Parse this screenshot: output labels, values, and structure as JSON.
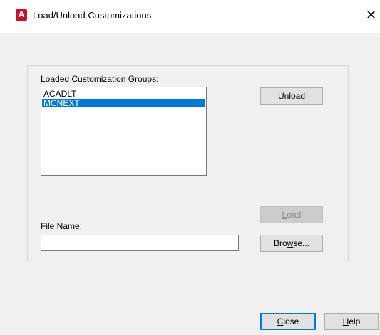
{
  "window": {
    "title": "Load/Unload Customizations",
    "close_glyph": "✕",
    "app_icon_letter": "A",
    "icon": "autocad-app-icon"
  },
  "groups": {
    "label": "Loaded Customization Groups:",
    "items": [
      "ACADLT",
      "MCNEXT"
    ],
    "selected_index": 1
  },
  "buttons": {
    "unload": {
      "pre": "",
      "key": "U",
      "post": "nload"
    },
    "load": {
      "pre": "",
      "key": "L",
      "post": "oad",
      "disabled": true
    },
    "browse": {
      "pre": "Bro",
      "key": "w",
      "post": "se..."
    },
    "close": {
      "pre": "",
      "key": "C",
      "post": "lose"
    },
    "help": {
      "pre": "",
      "key": "H",
      "post": "elp"
    }
  },
  "file_name": {
    "label_key": "F",
    "label_rest": "ile Name:",
    "value": ""
  },
  "colors": {
    "selection": "#0078d7",
    "app_icon": "#c8102e",
    "background": "#f0f0f0"
  }
}
